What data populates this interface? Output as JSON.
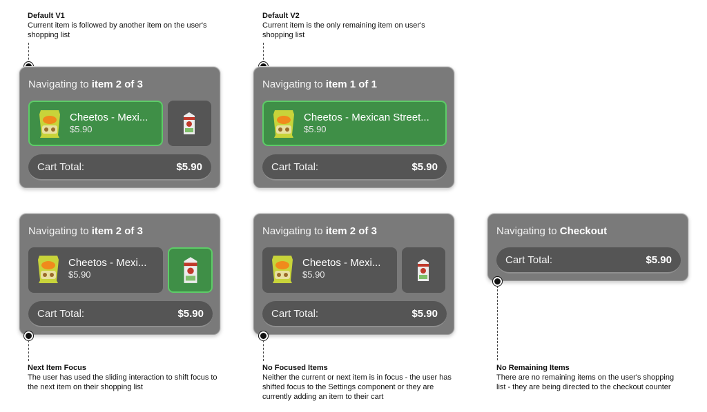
{
  "annotations": {
    "v1": {
      "title": "Default V1",
      "desc": "Current item is followed by another item on the user's shopping list"
    },
    "v2": {
      "title": "Default V2",
      "desc": "Current item is the only remaining item on user's shopping list"
    },
    "next_focus": {
      "title": "Next Item Focus",
      "desc": "The user has used the sliding interaction to shift focus to the next item on their shopping list"
    },
    "no_focus": {
      "title": "No Focused Items",
      "desc": "Neither the current or next item is in focus - the user has shifted focus to the Settings component or they are currently adding an item to their cart"
    },
    "no_remaining": {
      "title": "No Remaining Items",
      "desc": "There are no remaining items on the user's shopping list - they are being directed to the checkout counter"
    }
  },
  "common": {
    "nav_prefix": "Navigating to",
    "cart_total_label": "Cart Total:",
    "cart_total_value": "$5.90",
    "item_name": "Cheetos - Mexican Street Corn",
    "item_price": "$5.90"
  },
  "cards": {
    "v1": {
      "target": "item 2 of 3",
      "item_name": "Cheetos - Mexi...",
      "item_focus": true,
      "next_focus": false
    },
    "v2": {
      "target": "item 1 of 1",
      "item_name": "Cheetos - Mexican Street...",
      "item_focus": true
    },
    "next_focus": {
      "target": "item 2 of 3",
      "item_name": "Cheetos - Mexi...",
      "item_focus": false,
      "next_focus": true
    },
    "no_focus": {
      "target": "item 2 of 3",
      "item_name": "Cheetos - Mexi...",
      "item_focus": false,
      "next_focus": false
    },
    "checkout": {
      "target": "Checkout"
    }
  },
  "colors": {
    "focus_green": "#3f8f47",
    "focus_border": "#5dcc67",
    "card_bg": "#7a7a7a",
    "inner_bg": "#555555"
  }
}
